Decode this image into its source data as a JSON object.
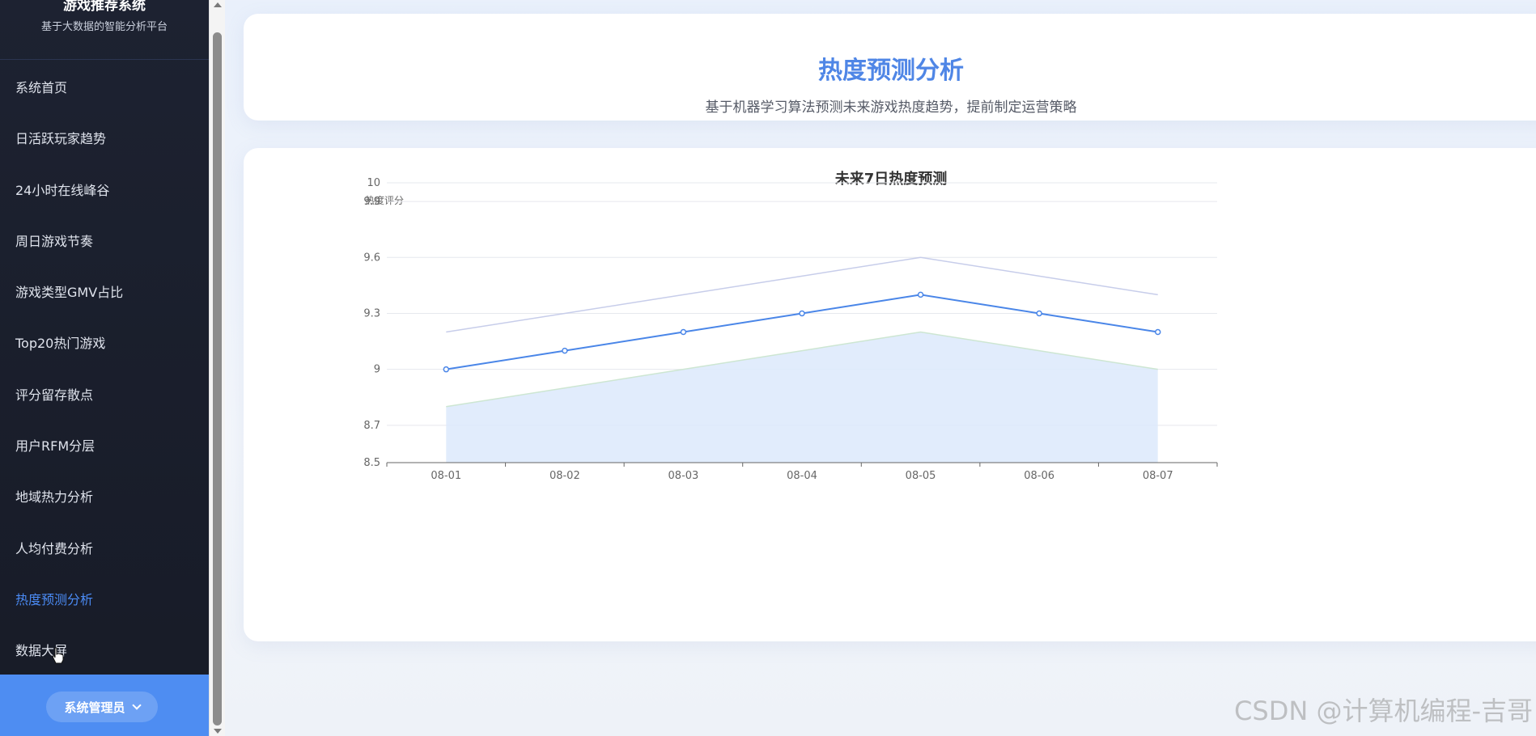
{
  "sidebar": {
    "brand_title": "游戏推荐系统",
    "brand_subtitle": "基于大数据的智能分析平台",
    "items": [
      {
        "label": "系统首页"
      },
      {
        "label": "日活跃玩家趋势"
      },
      {
        "label": "24小时在线峰谷"
      },
      {
        "label": "周日游戏节奏"
      },
      {
        "label": "游戏类型GMV占比"
      },
      {
        "label": "Top20热门游戏"
      },
      {
        "label": "评分留存散点"
      },
      {
        "label": "用户RFM分层"
      },
      {
        "label": "地域热力分析"
      },
      {
        "label": "人均付费分析"
      },
      {
        "label": "热度预测分析"
      },
      {
        "label": "数据大屏"
      }
    ],
    "active_index": 10,
    "user_label": "系统管理员"
  },
  "header": {
    "title": "热度预测分析",
    "subtitle": "基于机器学习算法预测未来游戏热度趋势，提前制定运营策略"
  },
  "colors": {
    "accent": "#4f86e6",
    "line": "#4a86e8",
    "upper": "#c7cdea",
    "lower": "#cde6d2",
    "area": "#dce9fb"
  },
  "chart_data": {
    "type": "line",
    "title": "未来7日热度预测",
    "ylabel": "热度评分",
    "categories": [
      "08-01",
      "08-02",
      "08-03",
      "08-04",
      "08-05",
      "08-06",
      "08-07"
    ],
    "yticks": [
      8.5,
      8.7,
      9,
      9.3,
      9.6,
      9.9,
      10
    ],
    "ylim": [
      8.5,
      10
    ],
    "grid": true,
    "series": [
      {
        "role": "predicted",
        "values": [
          9.0,
          9.1,
          9.2,
          9.3,
          9.4,
          9.3,
          9.2
        ]
      },
      {
        "role": "upper",
        "values": [
          9.2,
          9.3,
          9.4,
          9.5,
          9.6,
          9.5,
          9.4
        ]
      },
      {
        "role": "lower",
        "values": [
          8.8,
          8.9,
          9.0,
          9.1,
          9.2,
          9.1,
          9.0
        ]
      }
    ]
  },
  "watermark": "CSDN @计算机编程-吉哥"
}
